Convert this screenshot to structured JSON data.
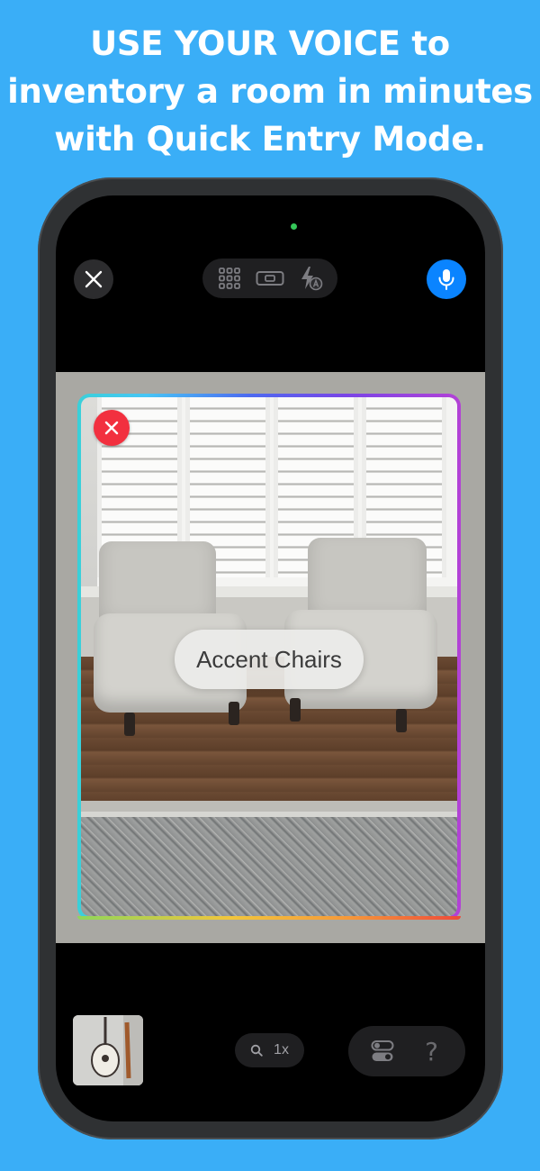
{
  "headline": {
    "line1": "USE YOUR VOICE to",
    "line2": "inventory a room in minutes",
    "line3": "with Quick Entry Mode."
  },
  "camera": {
    "top_controls": {
      "close_icon": "close-icon",
      "pill_icons": [
        "grid-icon",
        "level-icon",
        "flash-auto-icon"
      ],
      "mic_icon": "microphone-icon"
    },
    "detected_item": {
      "label": "Accent Chairs",
      "delete_icon": "close-icon"
    },
    "bottom_controls": {
      "zoom_label": "1x",
      "zoom_icon": "search-icon",
      "tools": [
        "toggle-icon",
        "help-icon"
      ],
      "help_glyph": "?"
    }
  },
  "colors": {
    "background": "#3aaef7",
    "mic_button": "#0a84ff",
    "delete_badge": "#f2303f",
    "status_dot": "#35c759"
  }
}
